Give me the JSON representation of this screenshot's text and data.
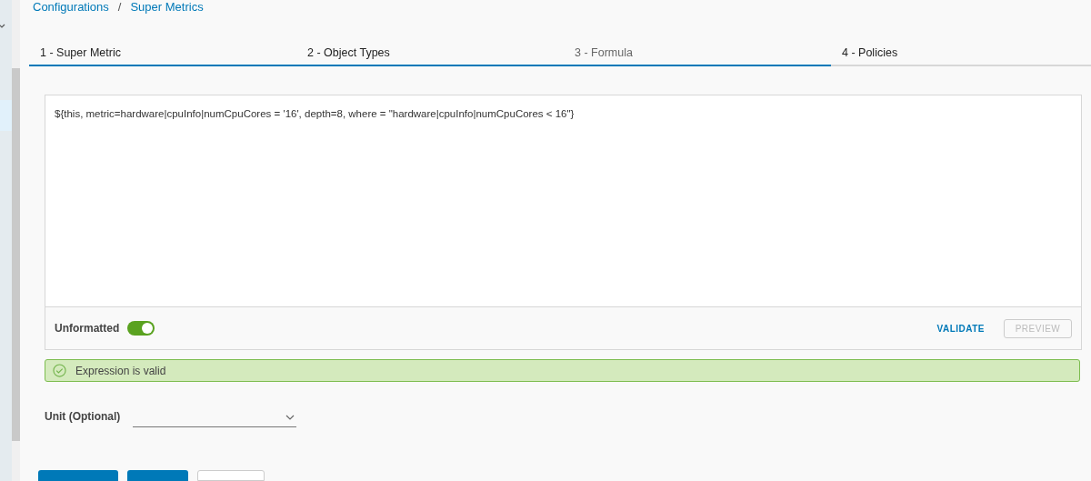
{
  "breadcrumb": [
    {
      "label": "Configurations"
    },
    {
      "label": "Super Metrics"
    }
  ],
  "breadcrumb_separator": "/",
  "tabs": [
    {
      "label": "1 - Super Metric",
      "completed": true,
      "selected": false
    },
    {
      "label": "2 - Object Types",
      "completed": true,
      "selected": false
    },
    {
      "label": "3 - Formula",
      "completed": true,
      "selected": true
    },
    {
      "label": "4 - Policies",
      "completed": false,
      "selected": false
    }
  ],
  "formula": {
    "value": "${this, metric=hardware|cpuInfo|numCpuCores = '16', depth=8, where = \"hardware|cpuInfo|numCpuCores < 16\"}"
  },
  "unformatted_toggle": {
    "label": "Unformatted",
    "on": true
  },
  "validate_button": {
    "label": "VALIDATE",
    "disabled": false
  },
  "preview_button": {
    "label": "PREVIEW",
    "disabled": true
  },
  "alert": {
    "kind": "success",
    "message": "Expression is valid"
  },
  "unit": {
    "label": "Unit (Optional)"
  },
  "footer_buttons": [
    {
      "kind": "primary"
    },
    {
      "kind": "primary"
    },
    {
      "kind": "secondary"
    }
  ]
}
